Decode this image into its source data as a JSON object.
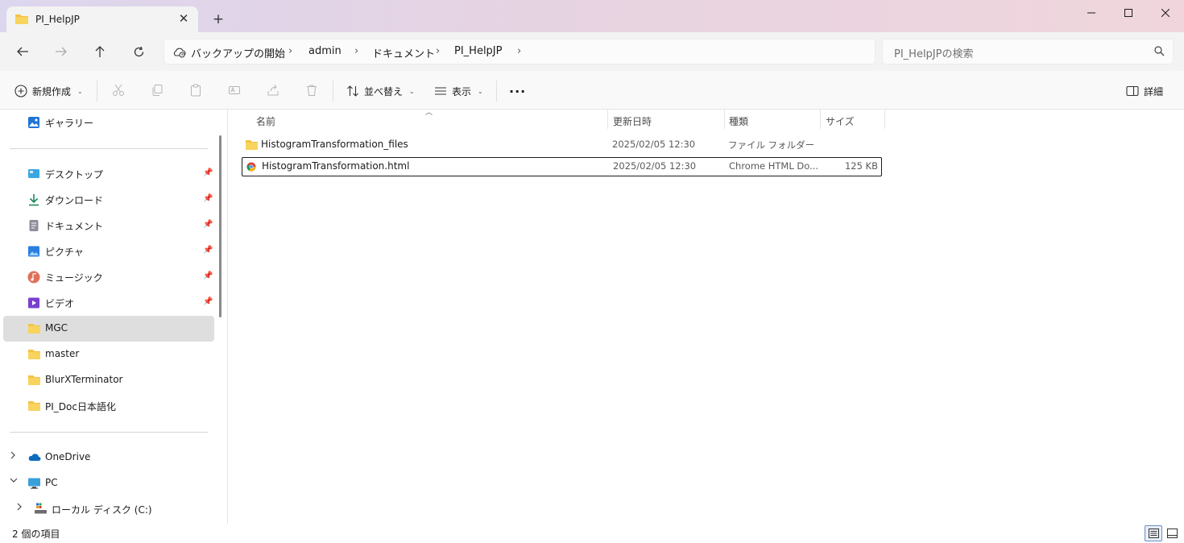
{
  "window": {
    "tab_title": "PI_HelpJP",
    "new_tab_glyph": "+",
    "close_tab_glyph": "✕"
  },
  "address": {
    "crumbs": [
      "バックアップの開始",
      "admin",
      "ドキュメント",
      "PI_HelpJP"
    ],
    "separator": "›"
  },
  "search": {
    "placeholder": "PI_HelpJPの検索"
  },
  "commands": {
    "new": "新規作成",
    "sort": "並べ替え",
    "view": "表示",
    "more": "···",
    "details": "詳細"
  },
  "sidebar": {
    "gallery": "ギャラリー",
    "quick_access": [
      {
        "label": "デスクトップ",
        "pinned": true,
        "icon": "desktop-icon"
      },
      {
        "label": "ダウンロード",
        "pinned": true,
        "icon": "download-icon"
      },
      {
        "label": "ドキュメント",
        "pinned": true,
        "icon": "document-icon"
      },
      {
        "label": "ピクチャ",
        "pinned": true,
        "icon": "pictures-icon"
      },
      {
        "label": "ミュージック",
        "pinned": true,
        "icon": "music-icon"
      },
      {
        "label": "ビデオ",
        "pinned": true,
        "icon": "video-icon"
      },
      {
        "label": "MGC",
        "pinned": false,
        "icon": "folder-icon",
        "selected": true
      },
      {
        "label": "master",
        "pinned": false,
        "icon": "folder-icon"
      },
      {
        "label": "BlurXTerminator",
        "pinned": false,
        "icon": "folder-icon"
      },
      {
        "label": "PI_Doc日本語化",
        "pinned": false,
        "icon": "folder-icon"
      }
    ],
    "onedrive": "OneDrive",
    "pc": "PC",
    "local_disk": "ローカル ディスク (C:)"
  },
  "columns": {
    "name": "名前",
    "modified": "更新日時",
    "type": "種類",
    "size": "サイズ"
  },
  "files": [
    {
      "name": "HistogramTransformation_files",
      "modified": "2025/02/05 12:30",
      "type": "ファイル フォルダー",
      "size": "",
      "icon": "folder-icon"
    },
    {
      "name": "HistogramTransformation.html",
      "modified": "2025/02/05 12:30",
      "type": "Chrome HTML Do...",
      "size": "125 KB",
      "icon": "chrome-html-icon",
      "focused": true
    }
  ],
  "status": {
    "item_count": "2 個の項目"
  },
  "colors": {
    "folder": "#f4c242",
    "accent": "#0067c0",
    "selected_bg": "#dedede"
  }
}
